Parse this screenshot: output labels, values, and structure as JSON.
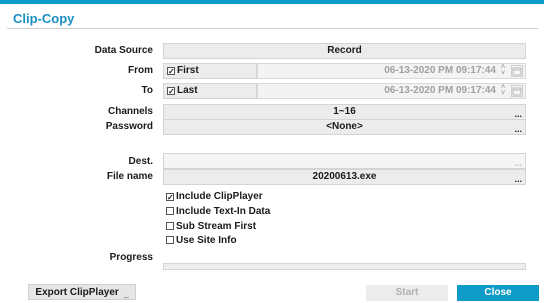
{
  "dialog": {
    "title": "Clip-Copy"
  },
  "labels": {
    "data_source": "Data Source",
    "from": "From",
    "to": "To",
    "channels": "Channels",
    "password": "Password",
    "dest": "Dest.",
    "file_name": "File name",
    "progress": "Progress"
  },
  "fields": {
    "data_source": "Record",
    "from_check": "First",
    "from_datetime": "06-13-2020  PM 09:17:44",
    "to_check": "Last",
    "to_datetime": "06-13-2020  PM 09:17:44",
    "channels": "1~16",
    "password": "<None>",
    "dest": "",
    "file_name": "20200613.exe",
    "browse_glyph": "..."
  },
  "options": [
    {
      "label": "Include ClipPlayer",
      "checked": true
    },
    {
      "label": "Include Text-In Data",
      "checked": false
    },
    {
      "label": "Sub Stream First",
      "checked": false
    },
    {
      "label": "Use Site Info",
      "checked": false
    }
  ],
  "progress_value": 0,
  "buttons": {
    "export": "Export ClipPlayer",
    "start": "Start",
    "close": "Close"
  },
  "colors": {
    "accent": "#0e9bc7",
    "title": "#1a8fc4"
  },
  "icons": {
    "check": "checkmark-icon",
    "spin": "spinner-arrows-icon",
    "calendar": "calendar-icon"
  }
}
